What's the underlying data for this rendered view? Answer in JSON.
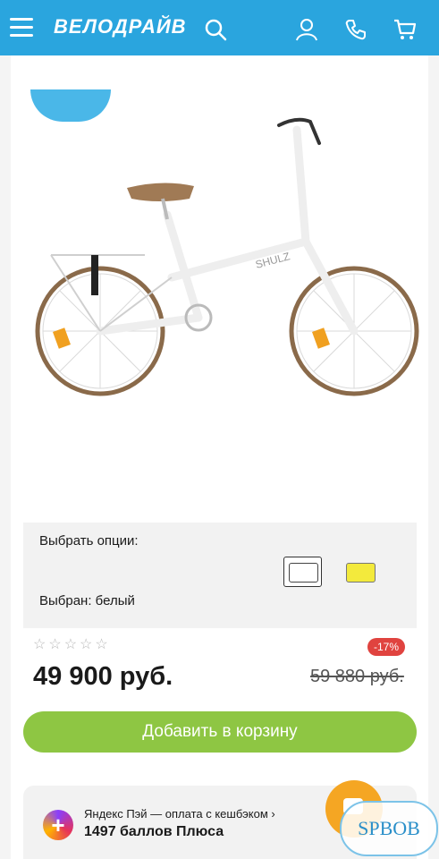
{
  "header": {
    "logo_text": "ВЕЛОДРАЙВ",
    "icons": [
      "menu-icon",
      "search-icon",
      "user-icon",
      "phone-icon",
      "cart-icon"
    ],
    "bg_color": "#2aa5de"
  },
  "product": {
    "image_brand_text": "SHULZ",
    "options": {
      "title": "Выбрать опции:",
      "selected_label": "Выбран: белый",
      "swatches": [
        {
          "name": "white",
          "color": "#ffffff",
          "selected": true
        },
        {
          "name": "yellow",
          "color": "#f3ea3c",
          "selected": false
        }
      ]
    },
    "rating_stars": "☆☆☆☆☆",
    "discount": "-17%",
    "price": "49 900 руб.",
    "old_price": "59 880 руб.",
    "add_to_cart_label": "Добавить в корзину",
    "accent_green": "#8ec643",
    "discount_red": "#e0433f"
  },
  "yandex_pay": {
    "line1": "Яндекс Пэй — оплата с кешбэком ›",
    "line2": "1497 баллов Плюса"
  },
  "watermark": "SPBOB"
}
